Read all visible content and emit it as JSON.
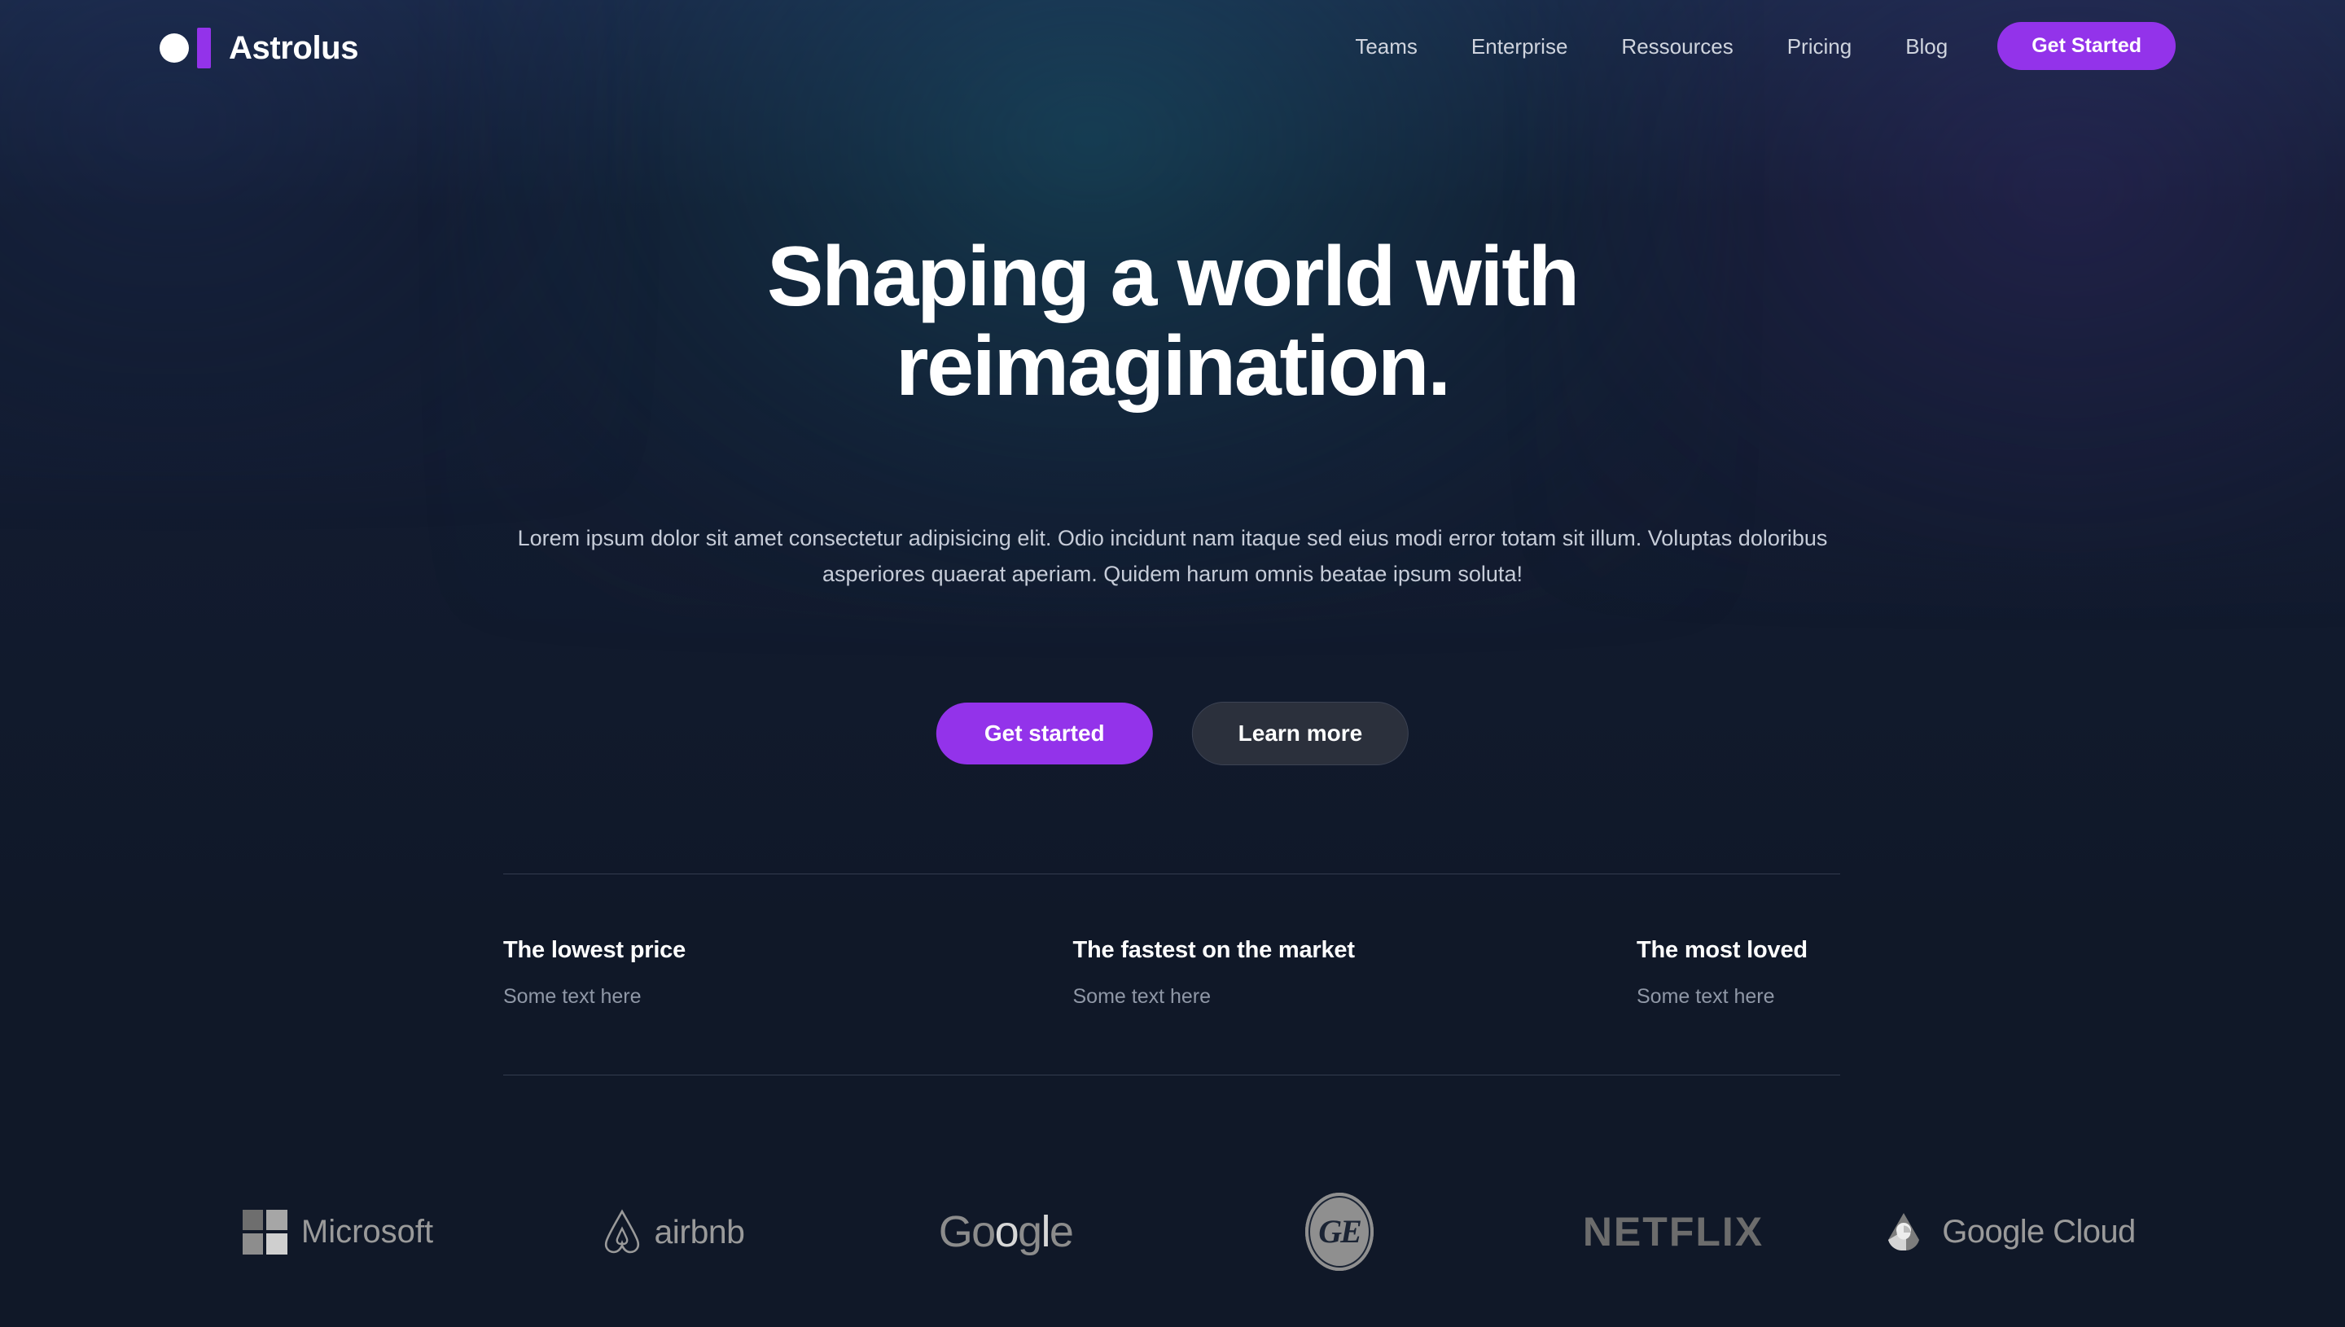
{
  "brand": {
    "name": "Astrolus",
    "mark_dot_color": "#ffffff",
    "mark_bar_color": "#9333ea"
  },
  "colors": {
    "accent_purple": "#9333ea",
    "page_background": "#101828",
    "heading_text": "#ffffff",
    "muted_text": "#8f97a6",
    "divider": "#333c4e",
    "secondary_button_bg": "#2b303c"
  },
  "header": {
    "nav": [
      {
        "label": "Teams"
      },
      {
        "label": "Enterprise"
      },
      {
        "label": "Ressources"
      },
      {
        "label": "Pricing"
      },
      {
        "label": "Blog"
      }
    ],
    "cta_label": "Get Started"
  },
  "hero": {
    "title_line_1": "Shaping a world with",
    "title_line_2": "reimagination.",
    "subtitle": "Lorem ipsum dolor sit amet consectetur adipisicing elit. Odio incidunt nam itaque sed eius modi error totam sit illum. Voluptas doloribus asperiores quaerat aperiam. Quidem harum omnis beatae ipsum soluta!",
    "primary_button_label": "Get started",
    "secondary_button_label": "Learn more"
  },
  "features": [
    {
      "title": "The lowest price",
      "text": "Some text here"
    },
    {
      "title": "The fastest on the market",
      "text": "Some text here"
    },
    {
      "title": "The most loved",
      "text": "Some text here"
    }
  ],
  "logos": [
    {
      "name": "Microsoft",
      "icon": "microsoft-logo-icon"
    },
    {
      "name": "airbnb",
      "icon": "airbnb-logo-icon"
    },
    {
      "name": "Google",
      "icon": "google-logo-icon"
    },
    {
      "name": "GE",
      "icon": "ge-logo-icon"
    },
    {
      "name": "NETFLIX",
      "icon": "netflix-logo-icon"
    },
    {
      "name": "Google Cloud",
      "icon": "google-cloud-logo-icon"
    }
  ],
  "google_wordmark": {
    "g1": "G",
    "o1": "o",
    "o2": "o",
    "g2": "g",
    "l": "l",
    "e": "e"
  },
  "ge_wordmark": "GE"
}
